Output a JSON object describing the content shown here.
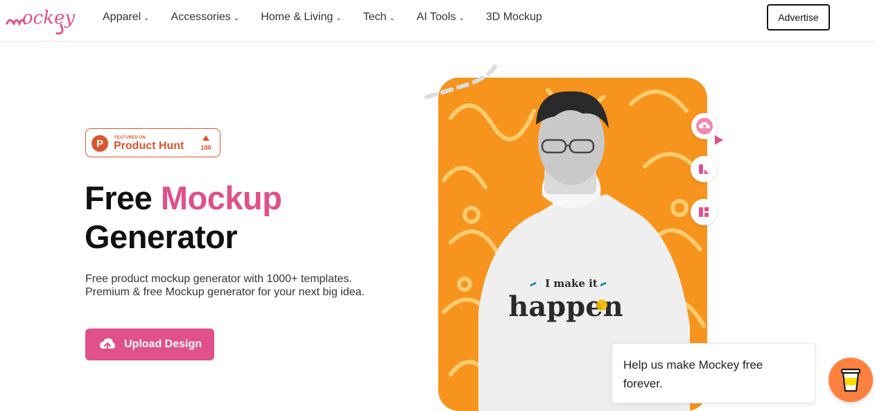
{
  "brand": {
    "logo_text": "mockey",
    "accent_color": "#e0508a"
  },
  "nav": {
    "items": [
      {
        "label": "Apparel",
        "has_dropdown": true
      },
      {
        "label": "Accessories",
        "has_dropdown": true
      },
      {
        "label": "Home & Living",
        "has_dropdown": true
      },
      {
        "label": "Tech",
        "has_dropdown": true
      },
      {
        "label": "AI Tools",
        "has_dropdown": true
      },
      {
        "label": "3D Mockup",
        "has_dropdown": false
      }
    ],
    "advertise_label": "Advertise"
  },
  "product_hunt": {
    "featured_label": "FEATURED ON",
    "name": "Product Hunt",
    "votes": "180",
    "color": "#da552f"
  },
  "hero": {
    "title_line1_plain": "Free ",
    "title_line1_accent": "Mockup",
    "title_line2": "Generator",
    "description": "Free product mockup generator with 1000+ templates. Premium & free Mockup generator for your next big idea.",
    "upload_label": "Upload Design"
  },
  "shirt": {
    "line1": "I make it",
    "line2": "happen"
  },
  "side_icons": [
    "upload-cloud-icon",
    "shapes-icon",
    "layout-icon"
  ],
  "help": {
    "text": "Help us make Mockey free forever."
  },
  "coffee": {
    "icon": "coffee-cup-icon",
    "color": "#ff813f"
  }
}
